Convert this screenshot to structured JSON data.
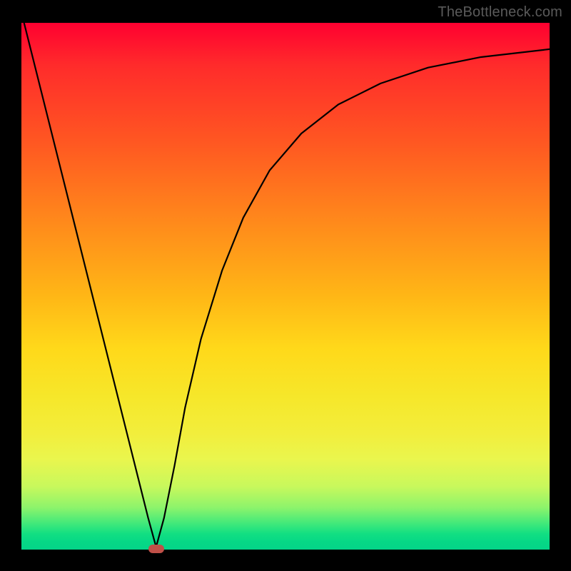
{
  "watermark": "TheBottleneck.com",
  "chart_data": {
    "type": "line",
    "title": "",
    "xlabel": "",
    "ylabel": "",
    "xlim": [
      0,
      100
    ],
    "ylim": [
      0,
      100
    ],
    "grid": false,
    "series": [
      {
        "name": "curve",
        "x": [
          0,
          5,
          10,
          15,
          20,
          22,
          24,
          25.5,
          27,
          29,
          31,
          34,
          38,
          42,
          47,
          53,
          60,
          68,
          77,
          87,
          100
        ],
        "values": [
          102,
          82,
          62,
          42,
          22,
          14,
          6,
          0.5,
          6,
          16,
          27,
          40,
          53,
          63,
          72,
          79,
          84.5,
          88.5,
          91.5,
          93.5,
          95
        ]
      }
    ],
    "marker": {
      "x": 25.5,
      "y": 0,
      "shape": "rounded-rect",
      "color": "#c05048"
    },
    "background_gradient": [
      "#ff0030",
      "#ff8a1b",
      "#ffd91a",
      "#04d488"
    ]
  }
}
